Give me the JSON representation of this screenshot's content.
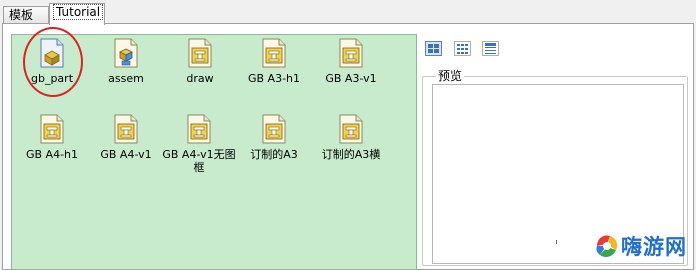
{
  "tabs": [
    {
      "label": "模板"
    },
    {
      "label": "Tutorial"
    }
  ],
  "templates": [
    {
      "label": "gb_part",
      "icon": "part-icon"
    },
    {
      "label": "assem",
      "icon": "assembly-icon"
    },
    {
      "label": "draw",
      "icon": "drawing-icon"
    },
    {
      "label": "GB A3-h1",
      "icon": "drawing-icon"
    },
    {
      "label": "GB A3-v1",
      "icon": "drawing-icon"
    },
    {
      "label": "GB A4-h1",
      "icon": "drawing-icon"
    },
    {
      "label": "GB A4-v1",
      "icon": "drawing-icon"
    },
    {
      "label": "GB A4-v1无图框",
      "icon": "drawing-icon"
    },
    {
      "label": "订制的A3",
      "icon": "drawing-icon"
    },
    {
      "label": "订制的A3横",
      "icon": "drawing-icon"
    }
  ],
  "view_buttons": [
    {
      "name": "large-icons-view-icon",
      "selected": true
    },
    {
      "name": "list-view-icon",
      "selected": false
    },
    {
      "name": "details-view-icon",
      "selected": false
    }
  ],
  "preview": {
    "title": "预览"
  },
  "watermark": {
    "text": "嗨游网"
  },
  "colors": {
    "grid_background": "#c7ebcc",
    "highlight_circle": "#e02020",
    "watermark": "#1f6fd0"
  }
}
